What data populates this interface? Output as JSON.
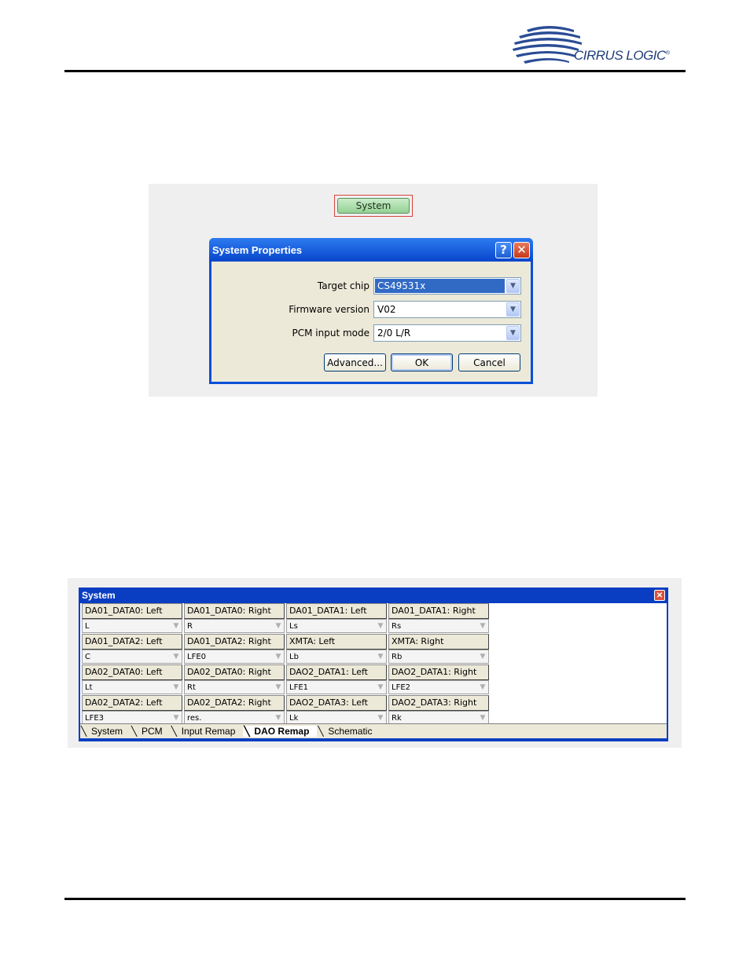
{
  "header": {
    "brand": "CIRRUS LOGIC",
    "trademark": "®"
  },
  "panel1": {
    "system_button_label": "System",
    "dialog": {
      "title": "System Properties",
      "help_label": "?",
      "close_label": "✕",
      "fields": [
        {
          "label": "Target chip",
          "value": "CS49531x",
          "selected": true
        },
        {
          "label": "Firmware version",
          "value": "V02",
          "selected": false
        },
        {
          "label": "PCM input mode",
          "value": "2/0 L/R",
          "selected": false
        }
      ],
      "buttons": {
        "advanced": "Advanced...",
        "ok": "OK",
        "cancel": "Cancel"
      }
    }
  },
  "panel2": {
    "title": "System",
    "close_label": "✕",
    "rows": [
      [
        {
          "header": "DA01_DATA0: Left",
          "value": "L"
        },
        {
          "header": "DA01_DATA0: Right",
          "value": "R"
        },
        {
          "header": "DA01_DATA1: Left",
          "value": "Ls"
        },
        {
          "header": "DA01_DATA1: Right",
          "value": "Rs"
        }
      ],
      [
        {
          "header": "DA01_DATA2: Left",
          "value": "C"
        },
        {
          "header": "DA01_DATA2: Right",
          "value": "LFE0"
        },
        {
          "header": "XMTA: Left",
          "value": "Lb"
        },
        {
          "header": "XMTA: Right",
          "value": "Rb"
        }
      ],
      [
        {
          "header": "DA02_DATA0: Left",
          "value": "Lt"
        },
        {
          "header": "DA02_DATA0: Right",
          "value": "Rt"
        },
        {
          "header": "DAO2_DATA1: Left",
          "value": "LFE1"
        },
        {
          "header": "DAO2_DATA1: Right",
          "value": "LFE2"
        }
      ],
      [
        {
          "header": "DA02_DATA2: Left",
          "value": "LFE3"
        },
        {
          "header": "DA02_DATA2: Right",
          "value": "res."
        },
        {
          "header": "DAO2_DATA3: Left",
          "value": "Lk"
        },
        {
          "header": "DAO2_DATA3: Right",
          "value": "Rk"
        }
      ]
    ],
    "tabs": [
      {
        "label": "System",
        "active": false
      },
      {
        "label": "PCM",
        "active": false
      },
      {
        "label": "Input Remap",
        "active": false
      },
      {
        "label": "DAO Remap",
        "active": true
      },
      {
        "label": "Schematic",
        "active": false
      }
    ]
  }
}
